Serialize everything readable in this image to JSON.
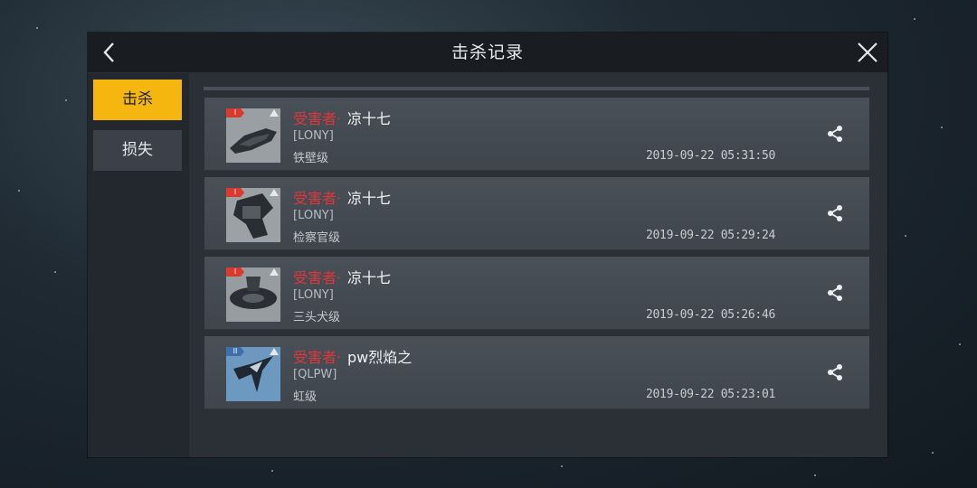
{
  "header": {
    "title": "击杀记录"
  },
  "tabs": [
    {
      "label": "击杀",
      "active": true
    },
    {
      "label": "损失",
      "active": false
    }
  ],
  "records": [
    {
      "tier": "I",
      "victim_label": "受害者·",
      "victim_name": "凉十七",
      "corp": "[LONY]",
      "ship": "铁壁级",
      "time": "2019-09-22 05:31:50"
    },
    {
      "tier": "I",
      "victim_label": "受害者·",
      "victim_name": "凉十七",
      "corp": "[LONY]",
      "ship": "检察官级",
      "time": "2019-09-22 05:29:24"
    },
    {
      "tier": "I",
      "victim_label": "受害者·",
      "victim_name": "凉十七",
      "corp": "[LONY]",
      "ship": "三头犬级",
      "time": "2019-09-22 05:26:46"
    },
    {
      "tier": "II",
      "victim_label": "受害者·",
      "victim_name": "pw烈焰之",
      "corp": "[QLPW]",
      "ship": "虹级",
      "time": "2019-09-22 05:23:01"
    }
  ],
  "colors": {
    "accent": "#f4b60f",
    "victim_label": "#e0373a",
    "tier_red": "#d93a2f",
    "tier_blue": "#3e6fa8"
  },
  "icons": {
    "back": "chevron-left-icon",
    "close": "close-icon",
    "share": "share-icon",
    "tier_badge": "tier-badge-icon",
    "ship_thumb": "ship-thumbnail"
  }
}
